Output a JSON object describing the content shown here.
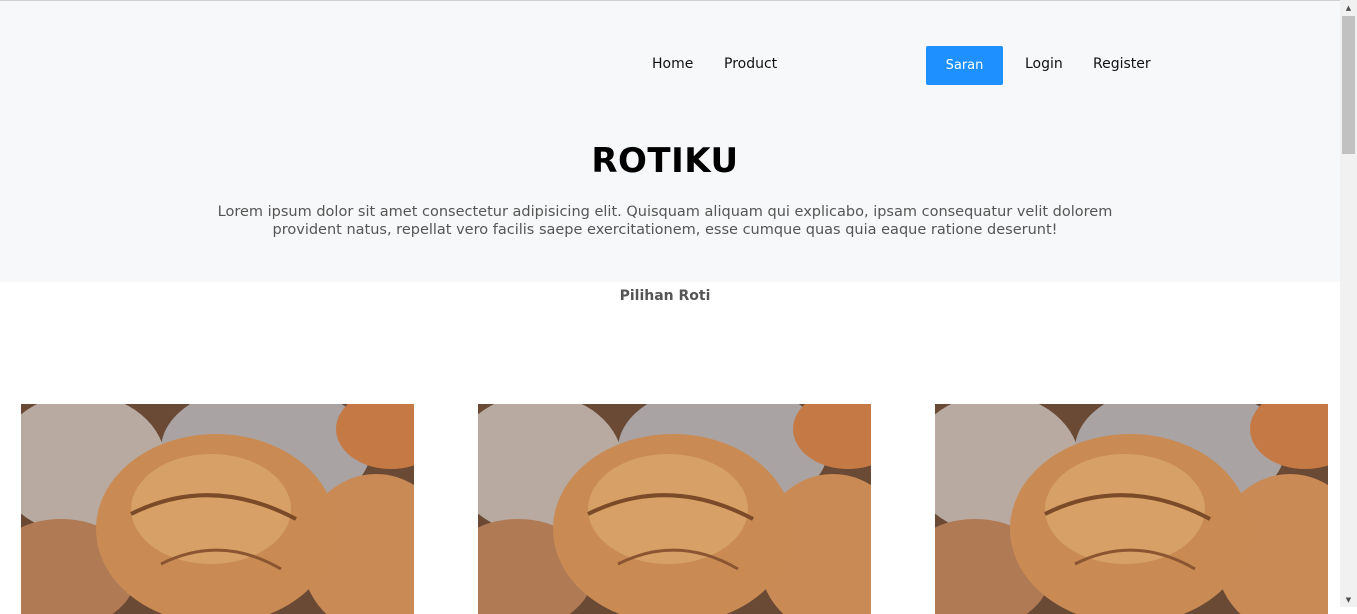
{
  "nav": {
    "home": "Home",
    "product": "Product",
    "saran": "Saran",
    "login": "Login",
    "register": "Register"
  },
  "hero": {
    "title": "ROTIKU",
    "lead": "Lorem ipsum dolor sit amet consectetur adipisicing elit. Quisquam aliquam qui explicabo, ipsam consequatur velit dolorem provident natus, repellat vero facilis saepe exercitationem, esse cumque quas quia eaque ratione deserunt!"
  },
  "section": {
    "title": "Pilihan Roti"
  },
  "products": [
    {
      "image": "bread-photo"
    },
    {
      "image": "bread-photo"
    },
    {
      "image": "bread-photo"
    }
  ],
  "colors": {
    "accent": "#1e90ff",
    "hero_bg": "#f7f8f9"
  }
}
